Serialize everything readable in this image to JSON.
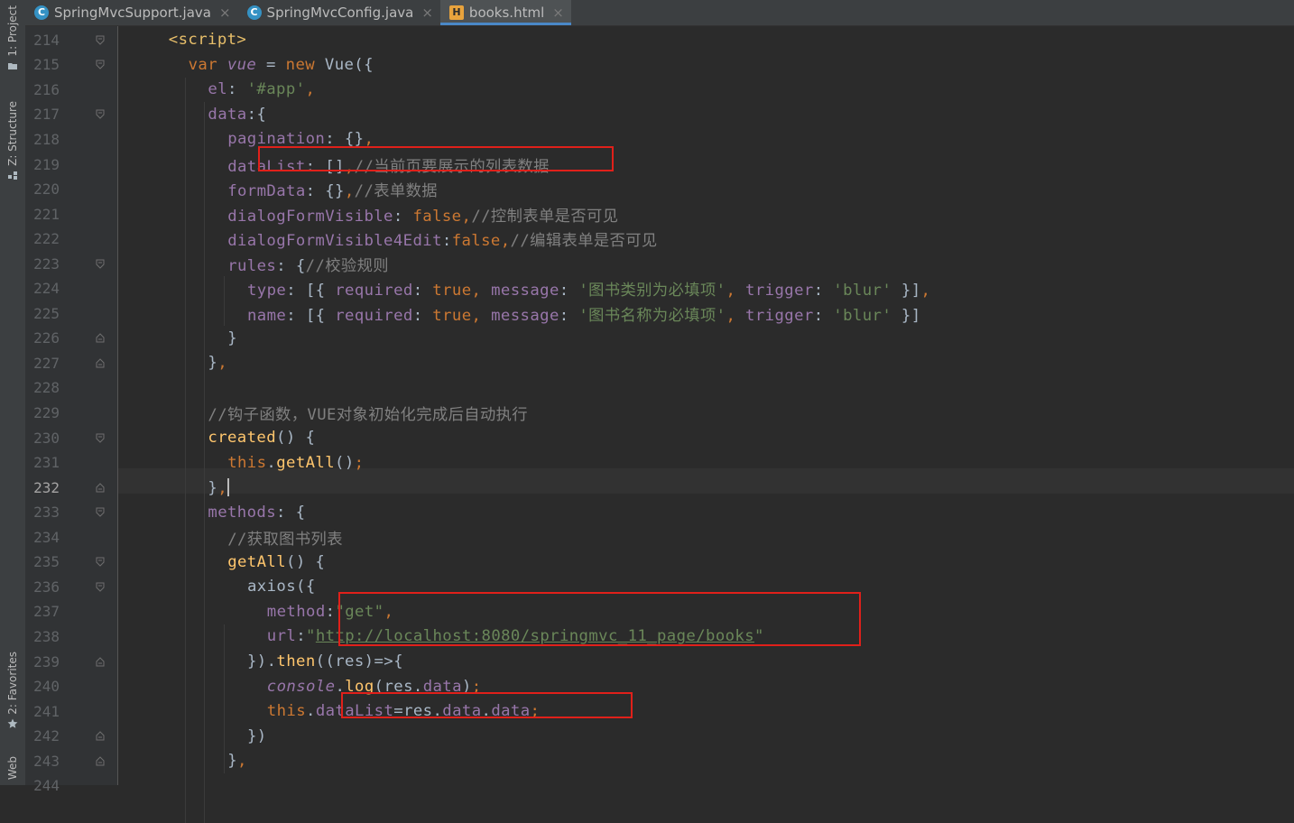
{
  "tool_window_tabs": [
    {
      "label": "1: Project",
      "icon": "folder-icon"
    },
    {
      "label": "Z: Structure",
      "icon": "structure-icon"
    },
    {
      "label": "2: Favorites",
      "icon": "star-icon"
    },
    {
      "label": "Web",
      "icon": "web-icon"
    }
  ],
  "editor_tabs": [
    {
      "label": "SpringMvcSupport.java",
      "icon": "java-class-icon",
      "active": false
    },
    {
      "label": "SpringMvcConfig.java",
      "icon": "java-class-icon",
      "active": false
    },
    {
      "label": "books.html",
      "icon": "html-file-icon",
      "active": true
    }
  ],
  "tab_close_glyph": "×",
  "current_line": "232",
  "colors": {
    "accent": "#4a88c7",
    "highlight_box": "#e0201a",
    "background": "#2b2b2b"
  },
  "lines": [
    {
      "n": "214",
      "tokens": [
        {
          "t": "<script>",
          "c": "tag"
        }
      ]
    },
    {
      "n": "215",
      "tokens": [
        {
          "t": "var",
          "c": "kw"
        },
        {
          "t": " "
        },
        {
          "t": "vue",
          "c": "italic-prop"
        },
        {
          "t": " = "
        },
        {
          "t": "new",
          "c": "kw"
        },
        {
          "t": " Vue({"
        }
      ]
    },
    {
      "n": "216",
      "tokens": [
        {
          "t": "el",
          "c": "prop"
        },
        {
          "t": ": "
        },
        {
          "t": "'#app'",
          "c": "str"
        },
        {
          "t": ",",
          "c": "kw"
        }
      ]
    },
    {
      "n": "217",
      "tokens": [
        {
          "t": "data",
          "c": "prop"
        },
        {
          "t": ":{"
        }
      ]
    },
    {
      "n": "218",
      "tokens": [
        {
          "t": "pagination",
          "c": "prop"
        },
        {
          "t": ": {}"
        },
        {
          "t": ",",
          "c": "kw"
        }
      ]
    },
    {
      "n": "219",
      "tokens": [
        {
          "t": "dataList",
          "c": "prop"
        },
        {
          "t": ": []"
        },
        {
          "t": ",",
          "c": "kw"
        },
        {
          "t": "//当前页要展示的列表数据",
          "c": "cmt"
        }
      ]
    },
    {
      "n": "220",
      "tokens": [
        {
          "t": "formData",
          "c": "prop"
        },
        {
          "t": ": {}"
        },
        {
          "t": ",",
          "c": "kw"
        },
        {
          "t": "//表单数据",
          "c": "cmt"
        }
      ]
    },
    {
      "n": "221",
      "tokens": [
        {
          "t": "dialogFormVisible",
          "c": "prop"
        },
        {
          "t": ": "
        },
        {
          "t": "false",
          "c": "kw"
        },
        {
          "t": ",",
          "c": "kw"
        },
        {
          "t": "//控制表单是否可见",
          "c": "cmt"
        }
      ]
    },
    {
      "n": "222",
      "tokens": [
        {
          "t": "dialogFormVisible4Edit",
          "c": "prop"
        },
        {
          "t": ":"
        },
        {
          "t": "false",
          "c": "kw"
        },
        {
          "t": ",",
          "c": "kw"
        },
        {
          "t": "//编辑表单是否可见",
          "c": "cmt"
        }
      ]
    },
    {
      "n": "223",
      "tokens": [
        {
          "t": "rules",
          "c": "prop"
        },
        {
          "t": ": {"
        },
        {
          "t": "//校验规则",
          "c": "cmt"
        }
      ]
    },
    {
      "n": "224",
      "tokens": [
        {
          "t": "type",
          "c": "prop"
        },
        {
          "t": ": [{ "
        },
        {
          "t": "required",
          "c": "prop"
        },
        {
          "t": ": "
        },
        {
          "t": "true",
          "c": "kw"
        },
        {
          "t": ", ",
          "c": "kw"
        },
        {
          "t": "message",
          "c": "prop"
        },
        {
          "t": ": "
        },
        {
          "t": "'图书类别为必填项'",
          "c": "str"
        },
        {
          "t": ", ",
          "c": "kw"
        },
        {
          "t": "trigger",
          "c": "prop"
        },
        {
          "t": ": "
        },
        {
          "t": "'blur'",
          "c": "str"
        },
        {
          "t": " }]"
        },
        {
          "t": ",",
          "c": "kw"
        }
      ]
    },
    {
      "n": "225",
      "tokens": [
        {
          "t": "name",
          "c": "prop"
        },
        {
          "t": ": [{ "
        },
        {
          "t": "required",
          "c": "prop"
        },
        {
          "t": ": "
        },
        {
          "t": "true",
          "c": "kw"
        },
        {
          "t": ", ",
          "c": "kw"
        },
        {
          "t": "message",
          "c": "prop"
        },
        {
          "t": ": "
        },
        {
          "t": "'图书名称为必填项'",
          "c": "str"
        },
        {
          "t": ", ",
          "c": "kw"
        },
        {
          "t": "trigger",
          "c": "prop"
        },
        {
          "t": ": "
        },
        {
          "t": "'blur'",
          "c": "str"
        },
        {
          "t": " }]"
        }
      ]
    },
    {
      "n": "226",
      "tokens": [
        {
          "t": "}"
        }
      ]
    },
    {
      "n": "227",
      "tokens": [
        {
          "t": "}"
        },
        {
          "t": ",",
          "c": "kw"
        }
      ]
    },
    {
      "n": "228",
      "tokens": []
    },
    {
      "n": "229",
      "tokens": [
        {
          "t": "//钩子函数，VUE对象初始化完成后自动执行",
          "c": "cmt"
        }
      ]
    },
    {
      "n": "230",
      "tokens": [
        {
          "t": "created",
          "c": "fn"
        },
        {
          "t": "() {"
        }
      ]
    },
    {
      "n": "231",
      "tokens": [
        {
          "t": "this",
          "c": "kw"
        },
        {
          "t": "."
        },
        {
          "t": "getAll",
          "c": "fn"
        },
        {
          "t": "()"
        },
        {
          "t": ";",
          "c": "kw"
        }
      ]
    },
    {
      "n": "232",
      "tokens": [
        {
          "t": "}"
        },
        {
          "t": ",",
          "c": "kw"
        }
      ]
    },
    {
      "n": "233",
      "tokens": [
        {
          "t": "methods",
          "c": "prop"
        },
        {
          "t": ": {"
        }
      ]
    },
    {
      "n": "234",
      "tokens": [
        {
          "t": "//获取图书列表",
          "c": "cmt"
        }
      ]
    },
    {
      "n": "235",
      "tokens": [
        {
          "t": "getAll",
          "c": "fn"
        },
        {
          "t": "() {"
        }
      ]
    },
    {
      "n": "236",
      "tokens": [
        {
          "t": "axios({"
        }
      ]
    },
    {
      "n": "237",
      "tokens": [
        {
          "t": "method",
          "c": "prop"
        },
        {
          "t": ":"
        },
        {
          "t": "\"get\"",
          "c": "str"
        },
        {
          "t": ",",
          "c": "kw"
        }
      ]
    },
    {
      "n": "238",
      "tokens": [
        {
          "t": "url",
          "c": "prop"
        },
        {
          "t": ":"
        },
        {
          "t": "\"",
          "c": "str"
        },
        {
          "t": "http://localhost:8080/springmvc_11_page/books",
          "c": "link"
        },
        {
          "t": "\"",
          "c": "str"
        }
      ]
    },
    {
      "n": "239",
      "tokens": [
        {
          "t": "})."
        },
        {
          "t": "then",
          "c": "fn"
        },
        {
          "t": "((res)=>{"
        }
      ]
    },
    {
      "n": "240",
      "tokens": [
        {
          "t": "console",
          "c": "italic-prop"
        },
        {
          "t": "."
        },
        {
          "t": "log",
          "c": "fn"
        },
        {
          "t": "(res."
        },
        {
          "t": "data",
          "c": "prop"
        },
        {
          "t": ")"
        },
        {
          "t": ";",
          "c": "kw"
        }
      ]
    },
    {
      "n": "241",
      "tokens": [
        {
          "t": "this",
          "c": "kw"
        },
        {
          "t": "."
        },
        {
          "t": "dataList",
          "c": "prop"
        },
        {
          "t": "=res."
        },
        {
          "t": "data",
          "c": "prop"
        },
        {
          "t": "."
        },
        {
          "t": "data",
          "c": "prop"
        },
        {
          "t": ";",
          "c": "kw"
        }
      ]
    },
    {
      "n": "242",
      "tokens": [
        {
          "t": "})"
        }
      ]
    },
    {
      "n": "243",
      "tokens": [
        {
          "t": "}"
        },
        {
          "t": ",",
          "c": "kw"
        }
      ]
    },
    {
      "n": "244",
      "tokens": []
    }
  ]
}
